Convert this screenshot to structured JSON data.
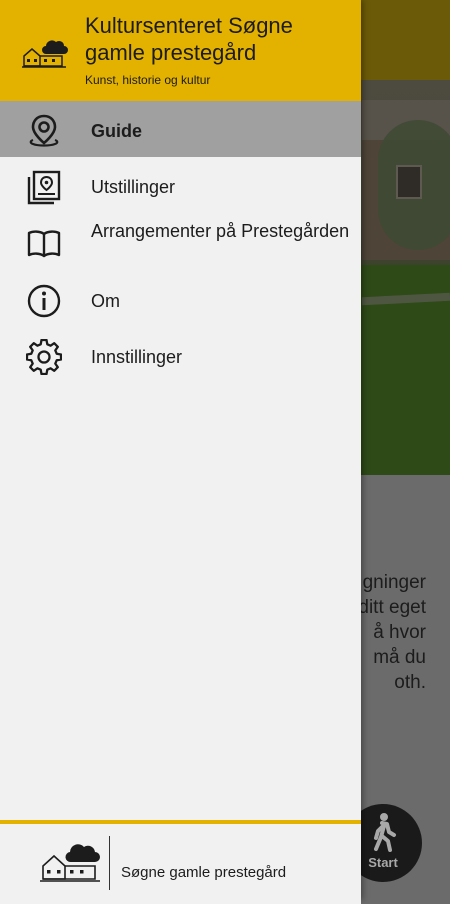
{
  "drawer": {
    "title": "Kultursenteret Søgne gamle prestegård",
    "subtitle": "Kunst, historie og kultur",
    "menu": [
      {
        "label": "Guide",
        "icon": "map-pin-icon",
        "active": true
      },
      {
        "label": "Utstillinger",
        "icon": "exhibition-icon",
        "active": false
      },
      {
        "label": "Arrangementer på Prestegården",
        "icon": "book-icon",
        "active": false
      },
      {
        "label": "Om",
        "icon": "info-icon",
        "active": false
      },
      {
        "label": "Innstillinger",
        "icon": "gear-icon",
        "active": false
      }
    ],
    "footer_text": "Søgne gamle prestegård"
  },
  "background": {
    "text_lines": [
      "gninger",
      "ditt eget",
      "å hvor",
      "må du",
      "oth."
    ],
    "start_button_label": "Start"
  },
  "colors": {
    "accent": "#e3b100",
    "drawer_bg": "#f1f1f1",
    "active_item": "#a0a0a0"
  }
}
